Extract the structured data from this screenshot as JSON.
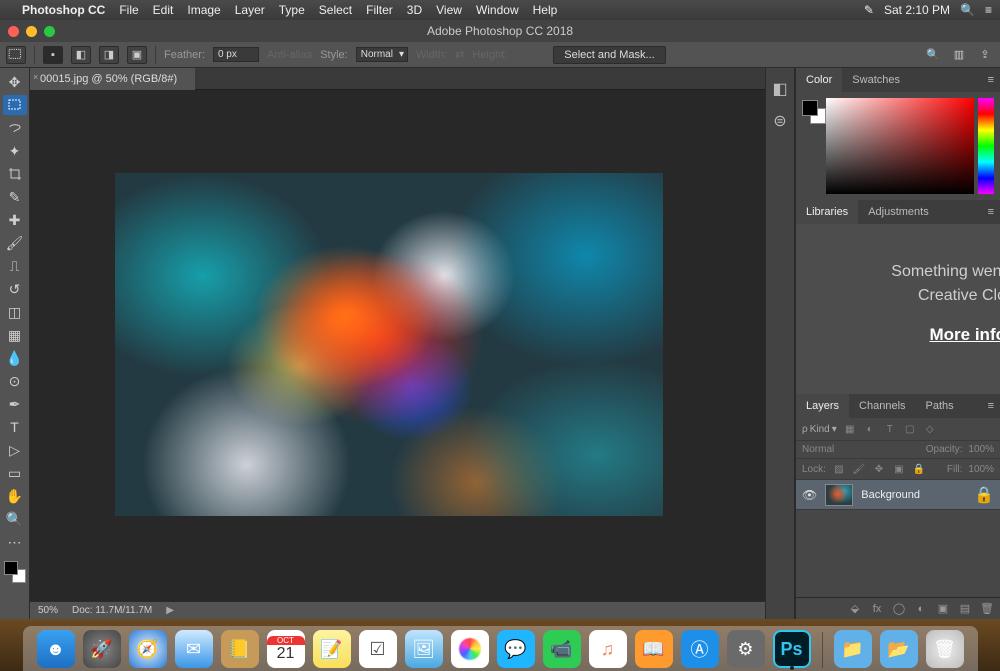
{
  "menubar": {
    "app": "Photoshop CC",
    "items": [
      "File",
      "Edit",
      "Image",
      "Layer",
      "Type",
      "Select",
      "Filter",
      "3D",
      "View",
      "Window",
      "Help"
    ],
    "clock": "Sat 2:10 PM"
  },
  "window": {
    "title": "Adobe Photoshop CC 2018"
  },
  "options": {
    "feather_label": "Feather:",
    "feather_value": "0 px",
    "antialias_label": "Anti-alias",
    "style_label": "Style:",
    "style_value": "Normal",
    "width_label": "Width:",
    "height_label": "Height:",
    "select_mask": "Select and Mask..."
  },
  "document": {
    "tab_label": "00015.jpg @ 50% (RGB/8#)",
    "zoom": "50%",
    "docsize": "Doc: 11.7M/11.7M"
  },
  "panels": {
    "color_tab": "Color",
    "swatches_tab": "Swatches",
    "libraries_tab": "Libraries",
    "adjustments_tab": "Adjustments",
    "lib_line1": "Something went",
    "lib_line2": "Creative Clo",
    "lib_link": "More info",
    "layers_tab": "Layers",
    "channels_tab": "Channels",
    "paths_tab": "Paths",
    "kind_label": "Kind",
    "blend_mode": "Normal",
    "opacity_label": "Opacity:",
    "opacity_value": "100%",
    "lock_label": "Lock:",
    "fill_label": "Fill:",
    "fill_value": "100%",
    "layer0_name": "Background"
  },
  "dock": {
    "cal_month": "OCT",
    "cal_day": "21",
    "ps_label": "Ps"
  }
}
